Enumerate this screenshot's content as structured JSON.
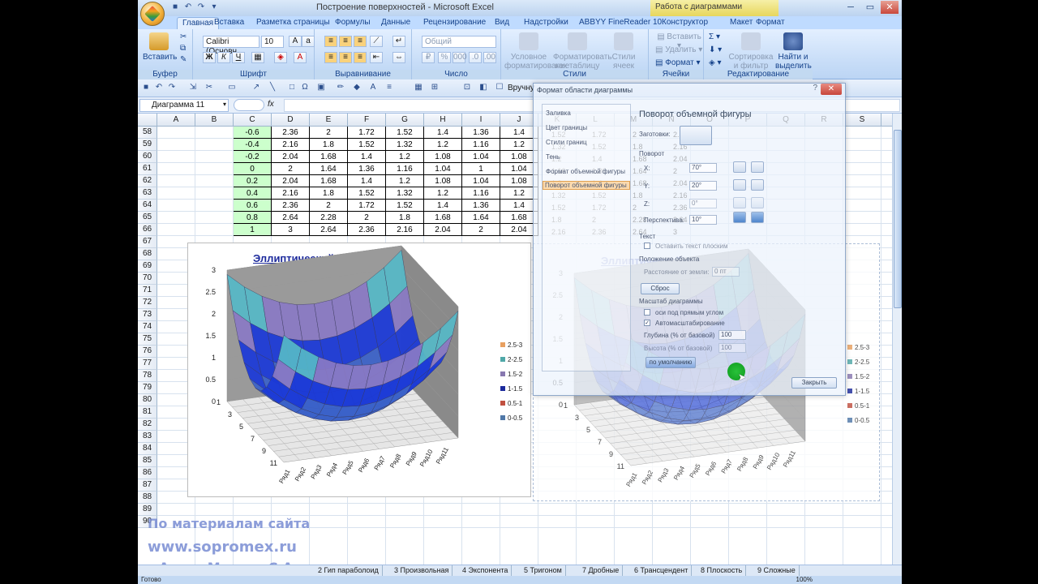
{
  "window": {
    "title": "Построение поверхностей - Microsoft Excel",
    "context_title": "Работа с диаграммами"
  },
  "tabs": [
    "Главная",
    "Вставка",
    "Разметка страницы",
    "Формулы",
    "Данные",
    "Рецензирование",
    "Вид",
    "Надстройки",
    "ABBYY FineReader 10",
    "Конструктор",
    "Макет",
    "Формат"
  ],
  "ribbon": {
    "paste": "Вставить",
    "clipboard": "Буфер обмена",
    "font_name": "Calibri (Основн",
    "font_size": "10",
    "font": "Шрифт",
    "alignment": "Выравнивание",
    "number_format": "Общий",
    "number": "Число",
    "cond_format": "Условное форматирование",
    "format_table": "Форматировать как таблицу",
    "cell_styles": "Стили ячеек",
    "styles": "Стили",
    "insert": "Вставить",
    "delete": "Удалить",
    "format": "Формат",
    "cells": "Ячейки",
    "sort_filter": "Сортировка и фильтр",
    "find_select": "Найти и выделить",
    "editing": "Редактирование"
  },
  "toolbar2": {
    "manual": "Вручну"
  },
  "formula_bar": {
    "name_box": "Диаграмма 11",
    "fx": "fx"
  },
  "columns": [
    "A",
    "B",
    "C",
    "D",
    "E",
    "F",
    "G",
    "H",
    "I",
    "J",
    "K",
    "L",
    "M",
    "N",
    "O",
    "P",
    "Q",
    "R",
    "S"
  ],
  "rows": [
    "58",
    "59",
    "60",
    "61",
    "62",
    "63",
    "64",
    "65",
    "66",
    "67",
    "68",
    "69",
    "70",
    "71",
    "72",
    "73",
    "74",
    "75",
    "76",
    "77",
    "78",
    "79",
    "80",
    "81",
    "82",
    "83",
    "84",
    "85",
    "86",
    "87",
    "88",
    "89",
    "90"
  ],
  "table": [
    [
      "-0.6",
      "2.36",
      "2",
      "1.72",
      "1.52",
      "1.4",
      "1.36",
      "1.4"
    ],
    [
      "-0.4",
      "2.16",
      "1.8",
      "1.52",
      "1.32",
      "1.2",
      "1.16",
      "1.2"
    ],
    [
      "-0.2",
      "2.04",
      "1.68",
      "1.4",
      "1.2",
      "1.08",
      "1.04",
      "1.08"
    ],
    [
      "0",
      "2",
      "1.64",
      "1.36",
      "1.16",
      "1.04",
      "1",
      "1.04"
    ],
    [
      "0.2",
      "2.04",
      "1.68",
      "1.4",
      "1.2",
      "1.08",
      "1.04",
      "1.08"
    ],
    [
      "0.4",
      "2.16",
      "1.8",
      "1.52",
      "1.32",
      "1.2",
      "1.16",
      "1.2"
    ],
    [
      "0.6",
      "2.36",
      "2",
      "1.72",
      "1.52",
      "1.4",
      "1.36",
      "1.4"
    ],
    [
      "0.8",
      "2.64",
      "2.28",
      "2",
      "1.8",
      "1.68",
      "1.64",
      "1.68"
    ],
    [
      "1",
      "3",
      "2.64",
      "2.36",
      "2.16",
      "2.04",
      "2",
      "2.04"
    ]
  ],
  "ghost_table": [
    [
      "1.52",
      "1.72",
      "2",
      "2.36"
    ],
    [
      "1.32",
      "1.52",
      "1.8",
      "2.16"
    ],
    [
      "1.2",
      "1.4",
      "1.68",
      "2.04"
    ],
    [
      "1.16",
      "1.36",
      "1.64",
      "2"
    ],
    [
      "1.2",
      "1.4",
      "1.68",
      "2.04"
    ],
    [
      "1.32",
      "1.52",
      "1.8",
      "2.16"
    ],
    [
      "1.52",
      "1.72",
      "2",
      "2.36"
    ],
    [
      "1.8",
      "2",
      "2.28",
      "2.64"
    ],
    [
      "2.16",
      "2.36",
      "2.64",
      "3"
    ]
  ],
  "chart": {
    "title": "Эллиптический параболоид",
    "z_ticks": [
      "3",
      "2.5",
      "2",
      "1.5",
      "1",
      "0.5",
      "0"
    ],
    "y_ticks": [
      "1",
      "3",
      "5",
      "7",
      "9",
      "11"
    ],
    "x_ticks": [
      "Ряд1",
      "Ряд2",
      "Ряд3",
      "Ряд4",
      "Ряд5",
      "Ряд6",
      "Ряд7",
      "Ряд8",
      "Ряд9",
      "Ряд10",
      "Ряд11"
    ],
    "legend": [
      {
        "label": "2.5-3",
        "color": "#e8a060"
      },
      {
        "label": "2-2.5",
        "color": "#50a8a8"
      },
      {
        "label": "1.5-2",
        "color": "#8878b0"
      },
      {
        "label": "1-1.5",
        "color": "#1c2a9c"
      },
      {
        "label": "0.5-1",
        "color": "#c05040"
      },
      {
        "label": "0-0.5",
        "color": "#5078a8"
      }
    ]
  },
  "dialog": {
    "title": "Формат области диаграммы",
    "help": "?",
    "close": "✕",
    "nav": [
      "Заливка",
      "Цвет границы",
      "Стили границ",
      "Тень",
      "Формат объемной фигуры",
      "Поворот объемной фигуры"
    ],
    "panel_title": "Поворот объемной фигуры",
    "presets": "Заготовки:",
    "rotation": "Поворот",
    "x_label": "X:",
    "x_value": "70°",
    "y_label": "Y:",
    "y_value": "20°",
    "z_label": "Z:",
    "z_value": "0°",
    "perspective": "Перспектива:",
    "perspective_value": "10°",
    "text_section": "Текст",
    "keep_text_flat": "Оставить текст плоским",
    "object_position": "Положение объекта",
    "distance": "Расстояние от земли:",
    "distance_value": "0 пт",
    "reset": "Сброс",
    "chart_scale": "Масштаб диаграммы",
    "right_angle_axes": "оси под прямым углом",
    "autoscale": "Автомасштабирование",
    "depth": "Глубина (% от базовой)",
    "depth_value": "100",
    "height": "Высота (% от базовой)",
    "height_value": "100",
    "default": "по умолчанию",
    "close_btn": "Закрыть"
  },
  "sheet_tabs": [
    "2 Гип параболоид",
    "3 Произвольная",
    "4 Экспонента",
    "5 Тригоном",
    "7 Дробные",
    "6 Трансцендент",
    "8 Плоскость",
    "9 Сложные"
  ],
  "status": {
    "ready": "Готово",
    "zoom": "100%"
  },
  "watermark": {
    "line1": "По материалам сайта",
    "line2": "www.sopromex.ru",
    "line3": "Автор Макеев С.А."
  }
}
